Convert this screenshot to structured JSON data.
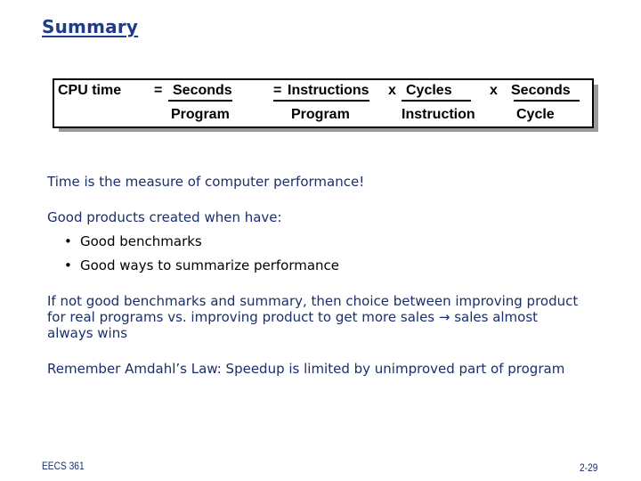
{
  "title": "Summary",
  "formula": {
    "lhs": "CPU time",
    "eq1": "=",
    "t1_num": "Seconds",
    "t1_den": "Program",
    "eq2": "=",
    "t2_num": "Instructions",
    "t2_den": "Program",
    "times1": "x",
    "t3_num": "Cycles",
    "t3_den": "Instruction",
    "times2": "x",
    "t4_num": "Seconds",
    "t4_den": "Cycle"
  },
  "statements": {
    "time_measure": "Time is the measure of computer performance!",
    "good_products": "Good products created when have:",
    "bullets": [
      "Good benchmarks",
      "Good ways to summarize performance"
    ],
    "bullet_glyph": "•",
    "not_good_line1": "If not good benchmarks and summary, then choice between improving product",
    "not_good_line2": "for real programs vs. improving product to get more sales → sales almost",
    "not_good_line3": "always wins",
    "amdahl": "Remember Amdahl’s Law: Speedup is limited by unimproved part of program"
  },
  "footer": {
    "course": "EECS 361",
    "page": "2-29"
  }
}
